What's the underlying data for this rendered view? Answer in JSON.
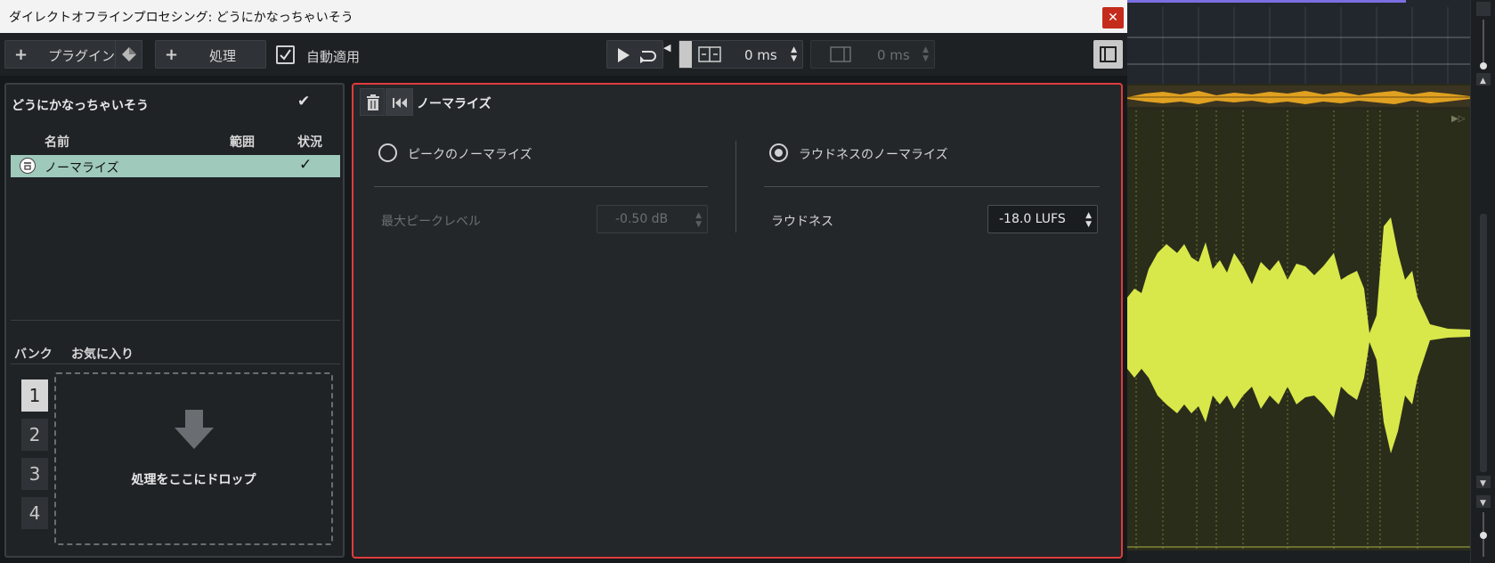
{
  "window": {
    "title": "ダイレクトオフラインプロセシング: どうにかなっちゃいそう",
    "close_glyph": "✕"
  },
  "toolbar": {
    "plugin_label": "プラグイン",
    "process_label": "処理",
    "auto_apply_label": "自動適用",
    "auto_apply_checked": true,
    "pre_roll_value": "0 ms",
    "post_roll_value": "0 ms"
  },
  "left_panel": {
    "clip_name": "どうにかなっちゃいそう",
    "columns": [
      "名前",
      "範囲",
      "状況"
    ],
    "processes": [
      {
        "name": "ノーマライズ",
        "range": "",
        "status": "✓"
      }
    ],
    "bank_label": "バンク",
    "favorites_label": "お気に入り",
    "banks": [
      "1",
      "2",
      "3",
      "4"
    ],
    "active_bank": "1",
    "drop_text": "処理をここにドロップ"
  },
  "right_panel": {
    "title": "ノーマライズ",
    "peak_option": "ピークのノーマライズ",
    "loudness_option": "ラウドネスのノーマライズ",
    "selected_option": "loudness",
    "max_peak_label": "最大ピークレベル",
    "max_peak_value": "-0.50 dB",
    "loudness_label": "ラウドネス",
    "loudness_value": "-18.0 LUFS"
  },
  "colors": {
    "accent_red": "#e03b3b",
    "selected_row": "#9ec9bb",
    "waveform": "#d8e84a",
    "overview": "#e0a020"
  }
}
